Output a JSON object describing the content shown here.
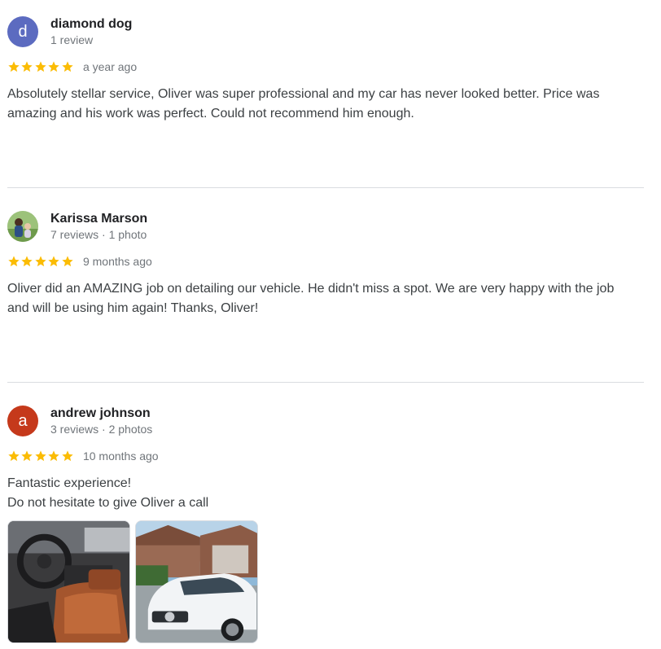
{
  "reviews": [
    {
      "avatar_letter": "d",
      "avatar_color": "#5c6bc0",
      "name": "diamond dog",
      "meta": "1 review",
      "rating": 5,
      "date": "a year ago",
      "text": "Absolutely stellar service, Oliver was super professional and my car has never looked better. Price was amazing and his work was perfect. Could not recommend him enough."
    },
    {
      "avatar_letter": "",
      "avatar_color": "#7cb342",
      "name": "Karissa Marson",
      "meta": "7 reviews · 1 photo",
      "rating": 5,
      "date": "9 months ago",
      "text": "Oliver did an AMAZING job on detailing our vehicle. He didn't miss a spot. We are very happy with the job and will be using him again! Thanks, Oliver!"
    },
    {
      "avatar_letter": "a",
      "avatar_color": "#c5391b",
      "name": "andrew johnson",
      "meta": "3 reviews · 2 photos",
      "rating": 5,
      "date": "10 months ago",
      "text_line1": "Fantastic experience!",
      "text_line2": "Do not hesitate to give Oliver a call",
      "photos": [
        "car-interior-photo",
        "white-car-exterior-photo"
      ]
    }
  ],
  "colors": {
    "star": "#fbbc04",
    "divider": "#dadce0",
    "secondary_text": "#70757a"
  }
}
